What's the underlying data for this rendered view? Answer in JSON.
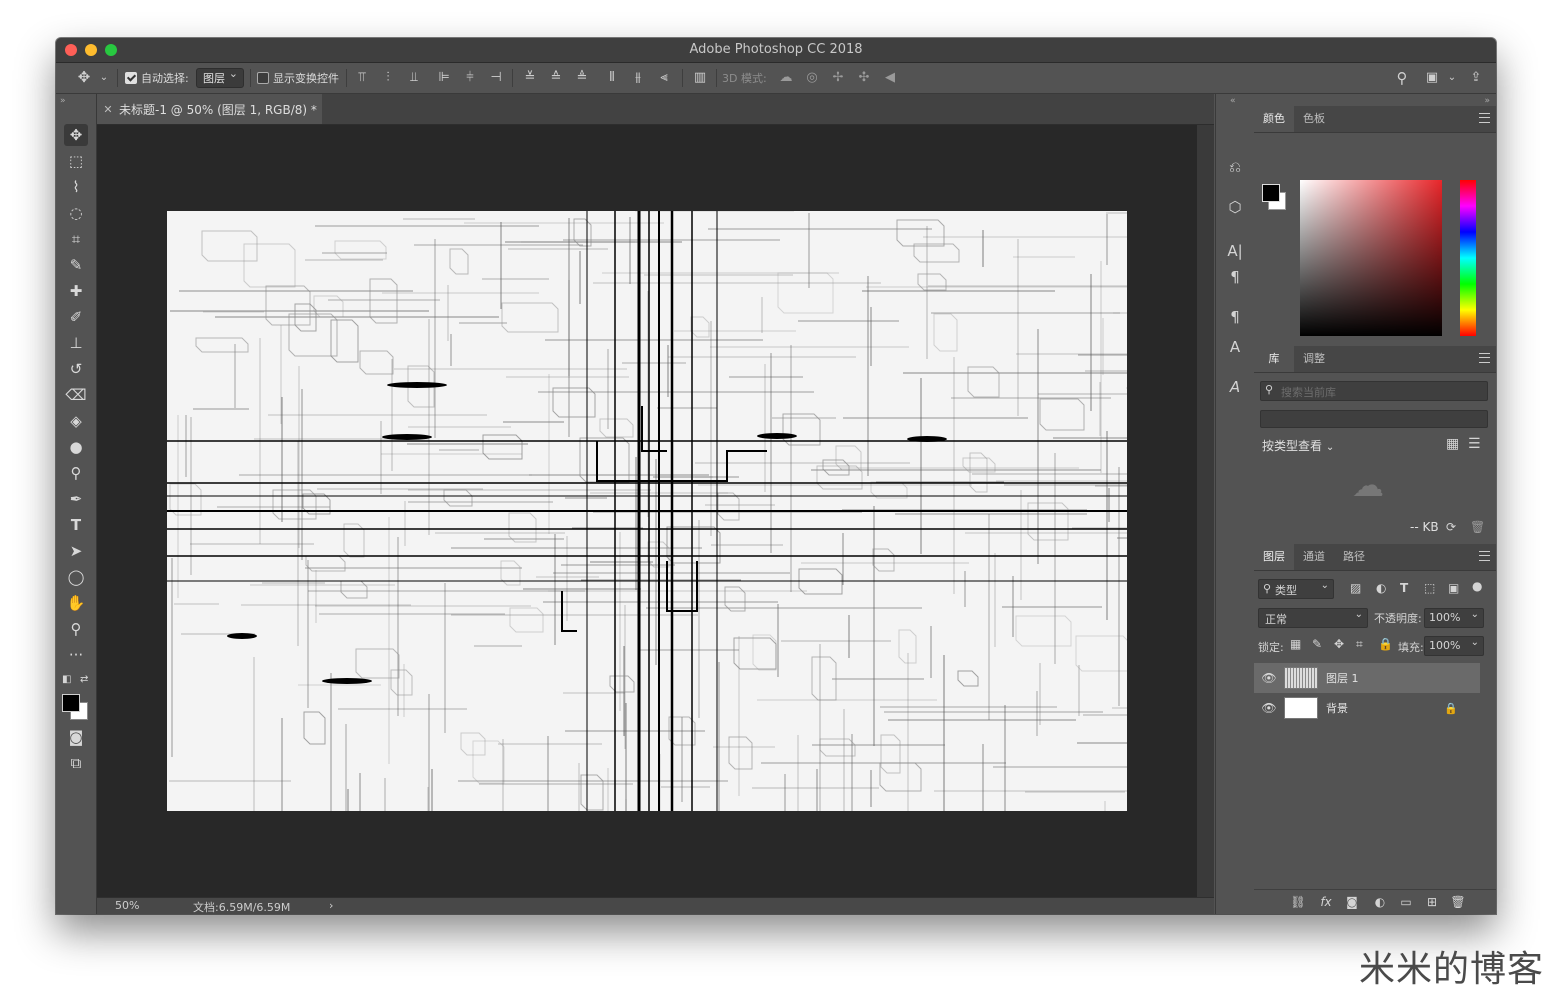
{
  "window": {
    "title": "Adobe Photoshop CC 2018"
  },
  "options_bar": {
    "auto_select_label": "自动选择:",
    "auto_select_value": "图层",
    "show_transform_label": "显示变换控件",
    "mode_3d_label": "3D 模式:"
  },
  "document": {
    "tab_title": "未标题-1 @ 50% (图层 1, RGB/8) *",
    "zoom": "50%",
    "doc_info": "文档:6.59M/6.59M"
  },
  "color_panel": {
    "tabs": [
      "颜色",
      "色板"
    ],
    "fg_color": "#000000",
    "bg_color": "#ffffff"
  },
  "library_panel": {
    "tabs": [
      "库",
      "调整"
    ],
    "search_placeholder": "搜索当前库",
    "view_by_label": "按类型查看",
    "size_label": "-- KB"
  },
  "layers_panel": {
    "tabs": [
      "图层",
      "通道",
      "路径"
    ],
    "filter_label": "类型",
    "blend_mode": "正常",
    "opacity_label": "不透明度:",
    "opacity_value": "100%",
    "lock_label": "锁定:",
    "fill_label": "填充:",
    "fill_value": "100%",
    "layers": [
      {
        "name": "图层 1",
        "selected": true
      },
      {
        "name": "背景",
        "locked": true
      }
    ]
  },
  "watermark": "米米的博客"
}
